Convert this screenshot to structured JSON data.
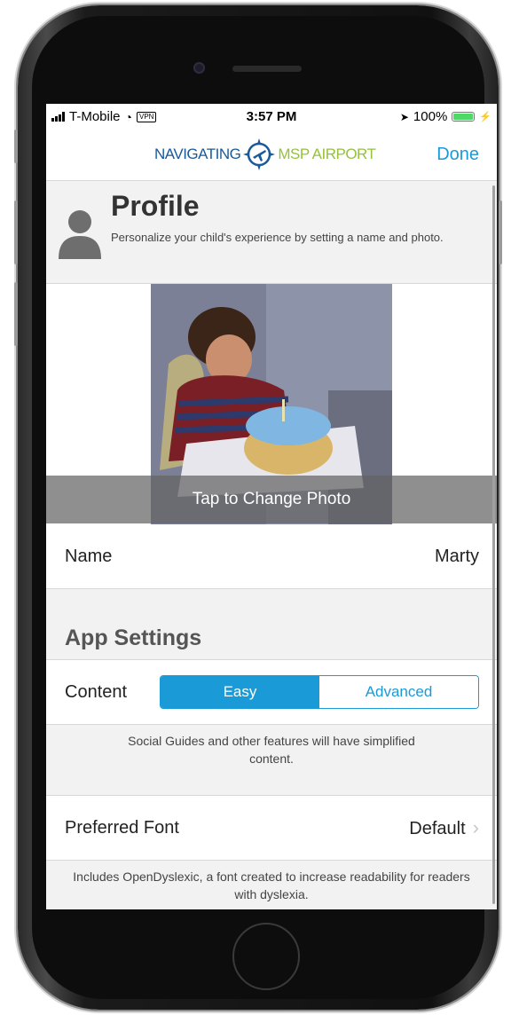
{
  "status_bar": {
    "carrier": "T-Mobile",
    "vpn": "VPN",
    "time": "3:57 PM",
    "battery": "100%"
  },
  "navbar": {
    "logo_left": "NAVIGATING",
    "logo_right": "MSP AIRPORT",
    "done_label": "Done"
  },
  "profile": {
    "title": "Profile",
    "subtitle": "Personalize your child's experience by setting a name and photo.",
    "photo_caption": "Tap to Change Photo"
  },
  "name_row": {
    "label": "Name",
    "value": "Marty"
  },
  "app_settings": {
    "title": "App Settings",
    "content_label": "Content",
    "options": [
      "Easy",
      "Advanced"
    ],
    "selected": "Easy",
    "content_helper": "Social Guides and other features will have simplified content.",
    "font_label": "Preferred Font",
    "font_value": "Default",
    "font_helper": "Includes OpenDyslexic, a font created to increase readability for readers with dyslexia."
  },
  "colors": {
    "accent": "#1a9ad6",
    "logo_blue": "#1a5a9a",
    "logo_green": "#95c13d",
    "battery": "#4cd964"
  }
}
